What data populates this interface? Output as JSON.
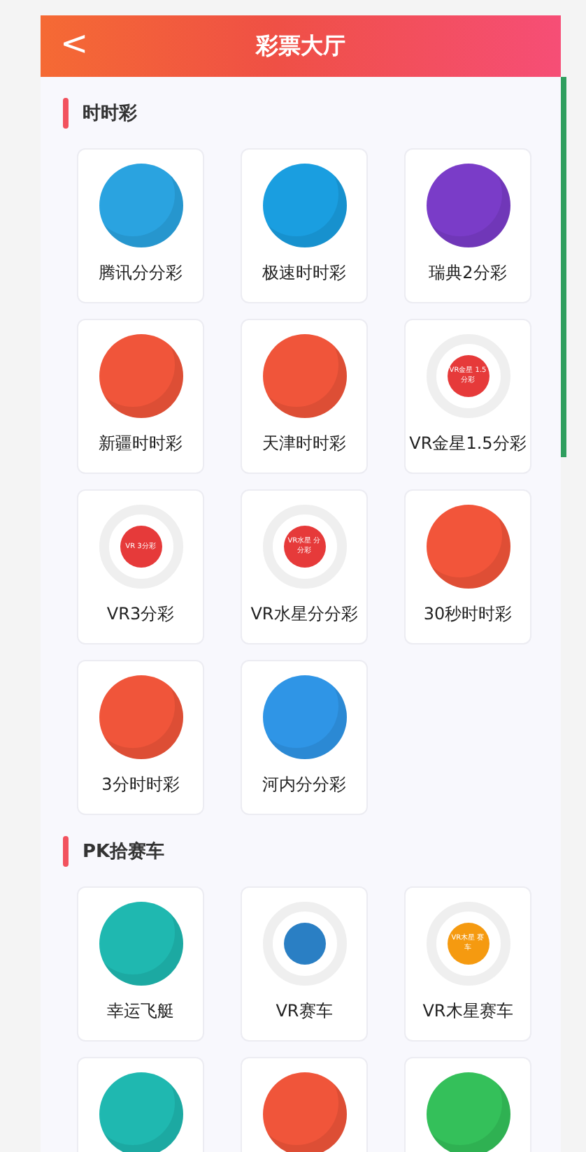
{
  "header": {
    "back": "<",
    "title": "彩票大厅"
  },
  "sections": [
    {
      "title": "时时彩",
      "games": [
        {
          "name": "腾讯分分彩",
          "kind": "ball",
          "color": "#2aa3e0"
        },
        {
          "name": "极速时时彩",
          "kind": "ball",
          "color": "#1a9ee0"
        },
        {
          "name": "瑞典2分彩",
          "kind": "ball",
          "color": "#7a3cc8"
        },
        {
          "name": "新疆时时彩",
          "kind": "ball",
          "color": "#f0553a"
        },
        {
          "name": "天津时时彩",
          "kind": "ball",
          "color": "#f0553a"
        },
        {
          "name": "VR金星1.5分彩",
          "kind": "ring",
          "color": "#e63a3a",
          "badge": "VR金星 1.5分彩"
        },
        {
          "name": "VR3分彩",
          "kind": "ring",
          "color": "#e63a3a",
          "badge": "VR 3分彩"
        },
        {
          "name": "VR水星分分彩",
          "kind": "ring",
          "color": "#e63a3a",
          "badge": "VR水星 分分彩"
        },
        {
          "name": "30秒时时彩",
          "kind": "ball",
          "color": "#f2553a"
        },
        {
          "name": "3分时时彩",
          "kind": "ball",
          "color": "#f0553a"
        },
        {
          "name": "河内分分彩",
          "kind": "ball",
          "color": "#2f95e6"
        }
      ]
    },
    {
      "title": "PK拾赛车",
      "games": [
        {
          "name": "幸运飞艇",
          "kind": "ball",
          "color": "#1fb8b0"
        },
        {
          "name": "VR赛车",
          "kind": "ring",
          "color": "#2a7fc4"
        },
        {
          "name": "VR木星赛车",
          "kind": "ring",
          "color": "#f59a10",
          "badge": "VR木星 赛车"
        },
        {
          "kind": "ball",
          "color": "#1fb8b0"
        },
        {
          "kind": "ball",
          "color": "#f0553a"
        },
        {
          "kind": "ball",
          "color": "#34c05a"
        }
      ]
    }
  ]
}
